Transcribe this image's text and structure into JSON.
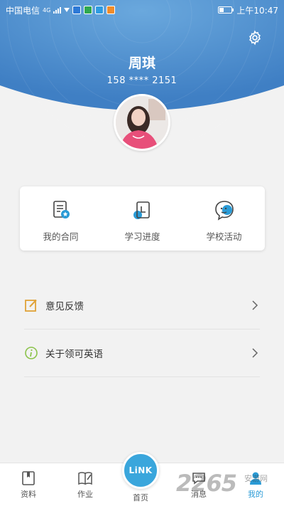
{
  "status_bar": {
    "carrier": "中国电信",
    "network": "4G",
    "time": "上午10:47"
  },
  "profile": {
    "name": "周琪",
    "phone": "158 **** 2151"
  },
  "quick_actions": [
    {
      "label": "我的合同",
      "icon": "contract-icon"
    },
    {
      "label": "学习进度",
      "icon": "progress-icon"
    },
    {
      "label": "学校活动",
      "icon": "activity-icon"
    }
  ],
  "menu": [
    {
      "label": "意见反馈",
      "icon": "feedback-icon"
    },
    {
      "label": "关于领可英语",
      "icon": "info-icon"
    }
  ],
  "tabs": [
    {
      "label": "资料",
      "icon": "materials-icon"
    },
    {
      "label": "作业",
      "icon": "homework-icon"
    },
    {
      "label": "首页",
      "icon": "home-icon"
    },
    {
      "label": "消息",
      "icon": "message-icon"
    },
    {
      "label": "我的",
      "icon": "me-icon"
    }
  ],
  "link_button": "LiNK",
  "watermark": {
    "main": "2265",
    "sub": "安游网"
  },
  "colors": {
    "header_blue": "#4d8fd0",
    "accent": "#2a9bd6",
    "feedback_orange": "#e0a238",
    "info_green": "#8bc34a"
  }
}
